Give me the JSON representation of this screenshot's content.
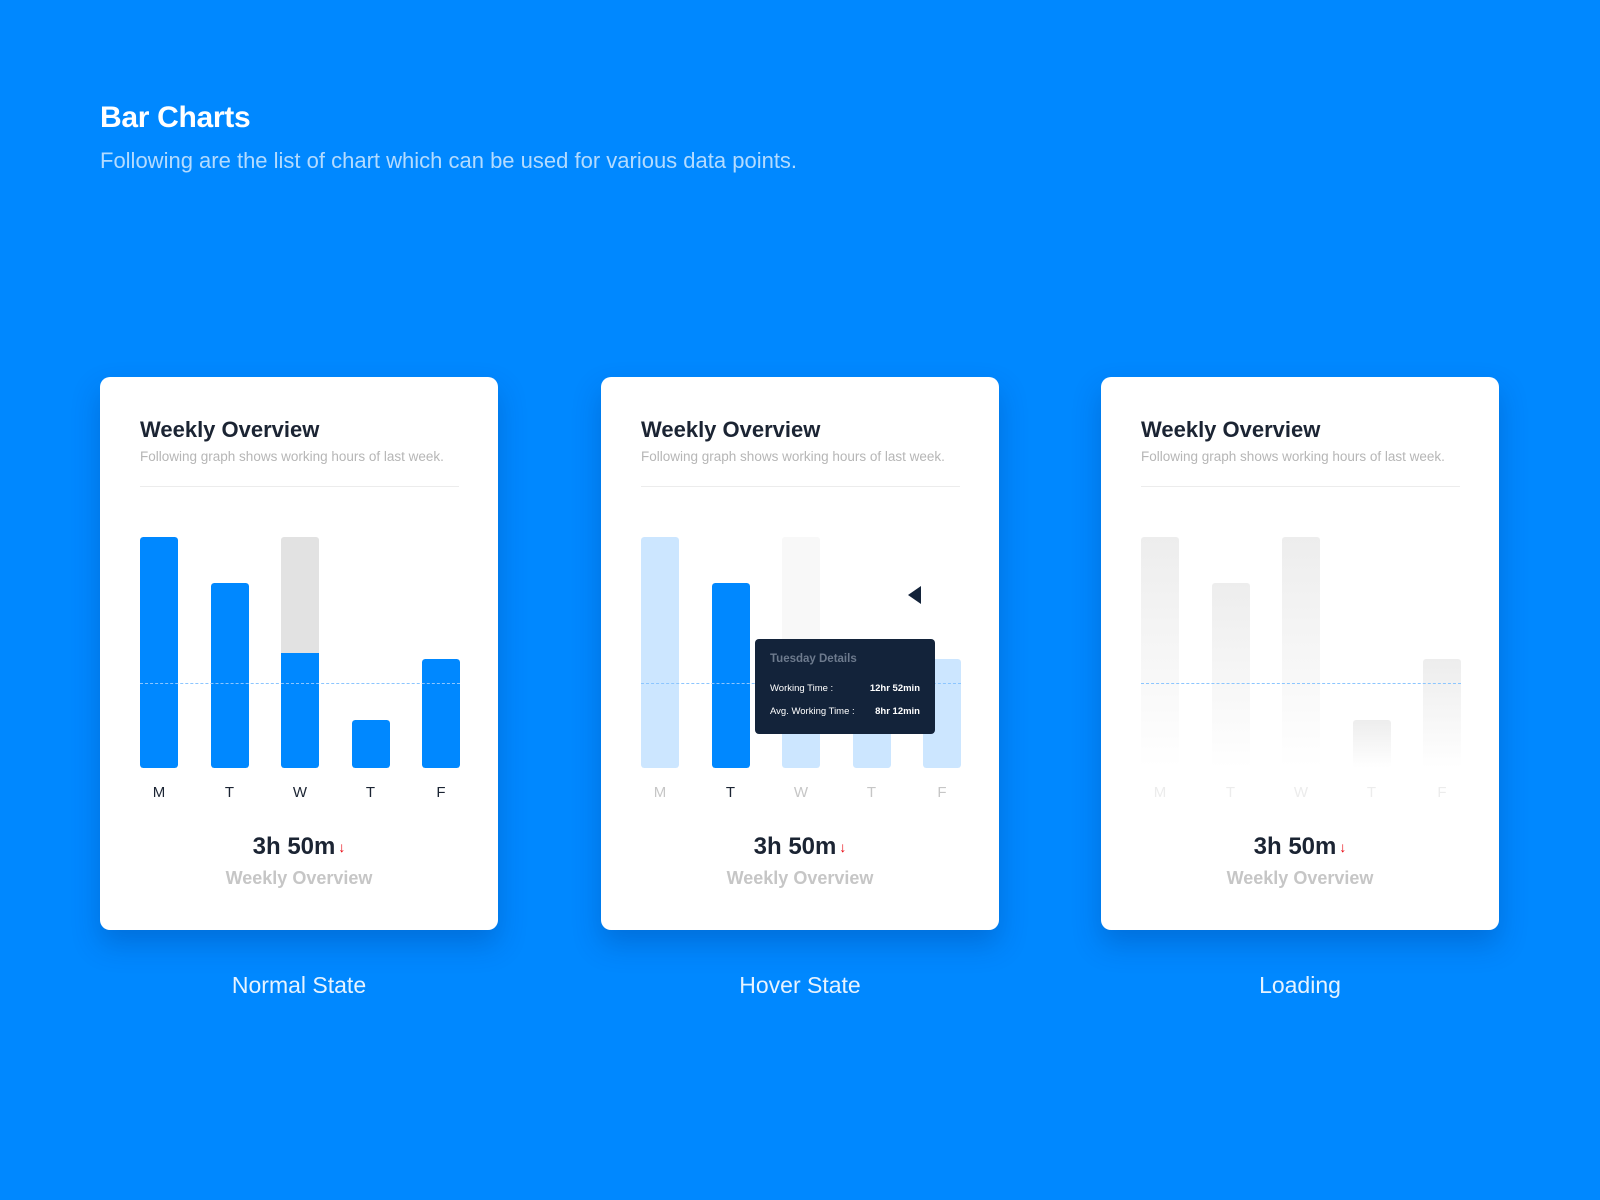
{
  "page": {
    "title": "Bar Charts",
    "subtitle": "Following are the list of chart which can be used for various data points."
  },
  "colors": {
    "background": "#0088ff",
    "bar_active": "#0088ff",
    "bar_faded": "#cce6ff",
    "bar_remainder": "#e2e2e2",
    "bar_remainder_faded": "#f8f8f8",
    "loading_bar_top": "#ededed",
    "loading_bar_bottom": "#ffffff",
    "avg_line": "#8cc6ff",
    "tooltip_bg": "#13233a",
    "down_arrow": "#e8000b"
  },
  "cards": [
    {
      "state": "normal",
      "state_label": "Normal State",
      "title": "Weekly Overview",
      "subtitle": "Following graph shows working hours of last week.",
      "total": "3h 50m",
      "trend": "down",
      "trend_icon": "↓",
      "total_label": "Weekly Overview"
    },
    {
      "state": "hover",
      "state_label": "Hover State",
      "title": "Weekly Overview",
      "subtitle": "Following graph shows working hours of last week.",
      "total": "3h 50m",
      "trend": "down",
      "trend_icon": "↓",
      "total_label": "Weekly Overview",
      "tooltip": {
        "title": "Tuesday Details",
        "rows": [
          {
            "label": "Working Time :",
            "value": "12hr 52min"
          },
          {
            "label": "Avg. Working Time :",
            "value": "8hr 12min"
          }
        ]
      }
    },
    {
      "state": "loading",
      "state_label": "Loading",
      "title": "Weekly Overview",
      "subtitle": "Following graph shows working hours of last week.",
      "total": "3h 50m",
      "trend": "down",
      "trend_icon": "↓",
      "total_label": "Weekly Overview"
    }
  ],
  "chart_data": [
    {
      "type": "bar",
      "title": "Weekly Overview",
      "state": "normal",
      "categories": [
        "M",
        "T",
        "W",
        "T",
        "F"
      ],
      "values": [
        1.0,
        0.8,
        0.5,
        0.21,
        0.47
      ],
      "remainder": [
        0,
        0,
        0.5,
        0,
        0
      ],
      "average": 0.37,
      "ylim": [
        0,
        1
      ],
      "highlight_index": null,
      "grid": false
    },
    {
      "type": "bar",
      "title": "Weekly Overview",
      "state": "hover",
      "categories": [
        "M",
        "T",
        "W",
        "T",
        "F"
      ],
      "values": [
        1.0,
        0.8,
        0.5,
        0.21,
        0.47
      ],
      "remainder": [
        0,
        0,
        0.5,
        0,
        0
      ],
      "average": 0.37,
      "ylim": [
        0,
        1
      ],
      "highlight_index": 1,
      "grid": false
    },
    {
      "type": "bar",
      "title": "Weekly Overview",
      "state": "loading",
      "categories": [
        "M",
        "T",
        "W",
        "T",
        "F"
      ],
      "values": [
        1.0,
        0.8,
        1.0,
        0.21,
        0.47
      ],
      "remainder": [
        0,
        0,
        0,
        0,
        0
      ],
      "average": 0.37,
      "ylim": [
        0,
        1
      ],
      "highlight_index": null,
      "grid": false
    }
  ]
}
